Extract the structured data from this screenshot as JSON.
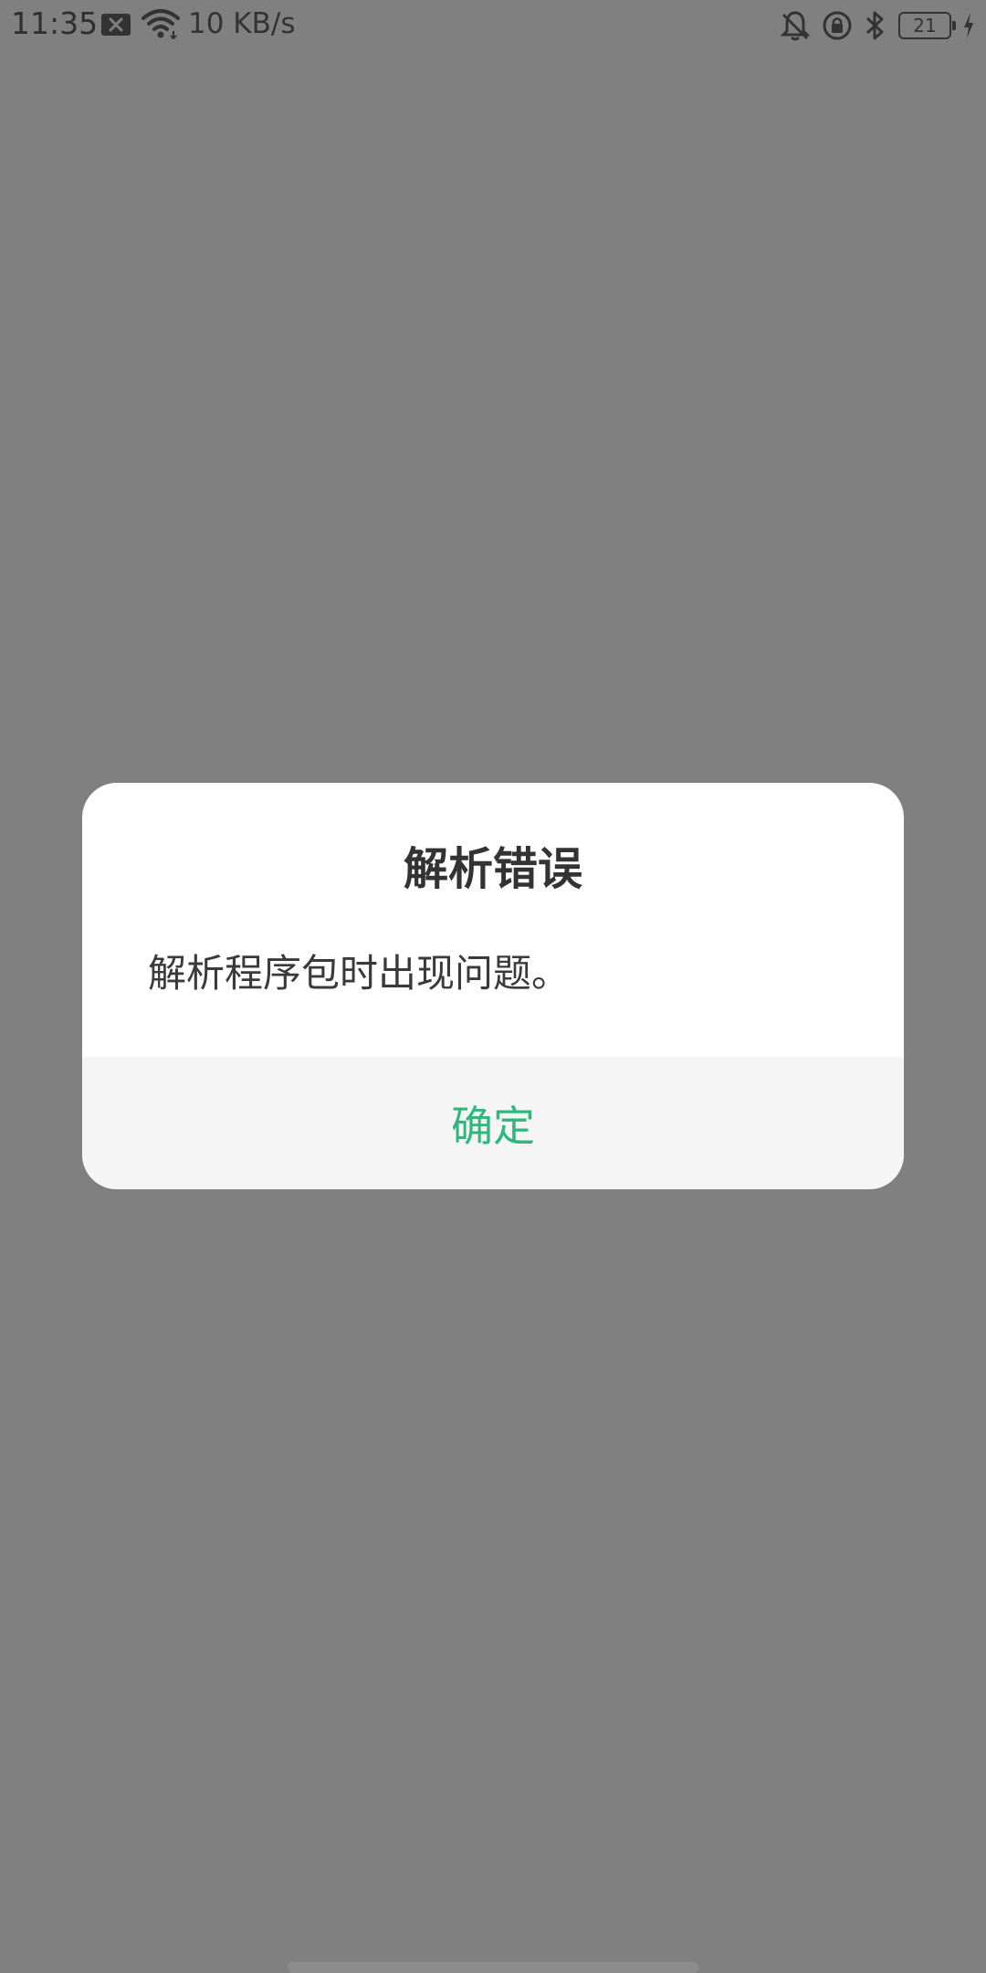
{
  "status_bar": {
    "time": "11:35",
    "net_speed": "10 KB/s",
    "battery_level": "21",
    "icons": [
      "close-box-icon",
      "wifi-icon",
      "mute-bell-icon",
      "rotation-lock-icon",
      "bluetooth-icon",
      "battery-icon",
      "charging-icon"
    ]
  },
  "dialog": {
    "title": "解析错误",
    "message": "解析程序包时出现问题。",
    "confirm_label": "确定"
  },
  "colors": {
    "scrim": "#808080",
    "dialog_bg": "#ffffff",
    "footer_bg": "#f5f5f5",
    "accent": "#2fb77e",
    "text": "#333333"
  }
}
